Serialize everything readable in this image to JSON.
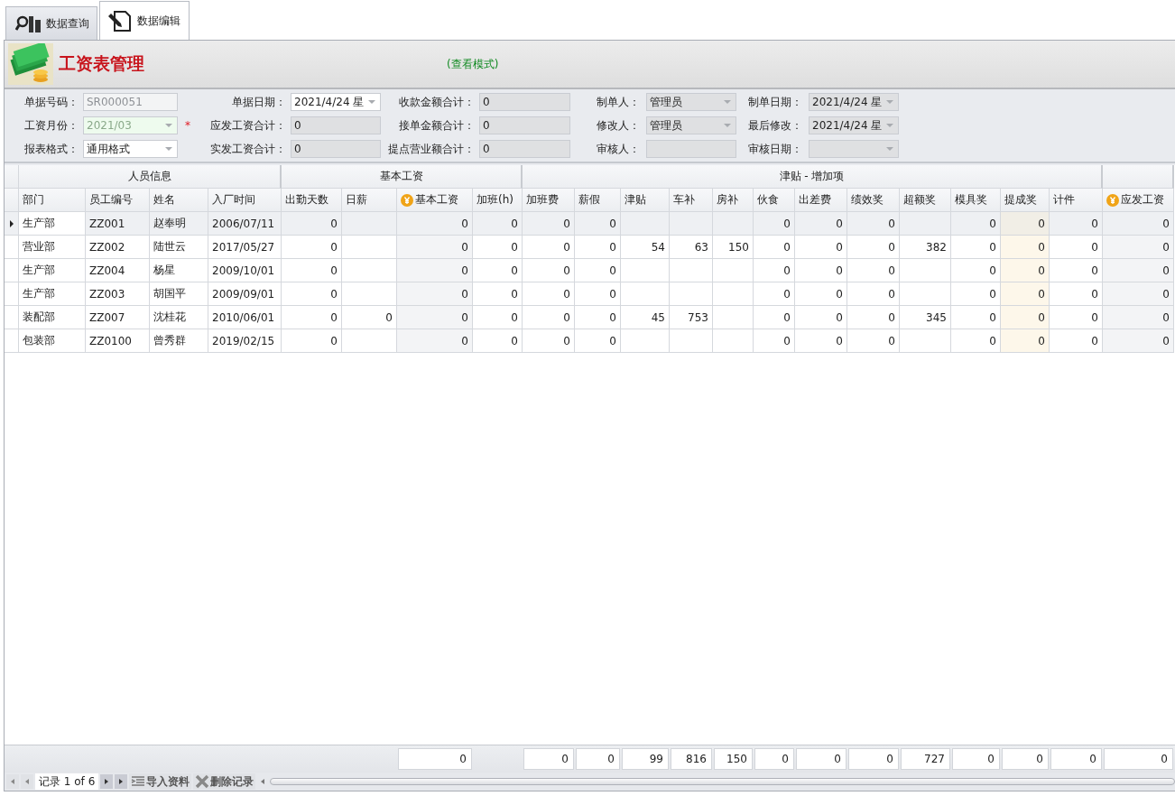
{
  "tabs": [
    {
      "label": "数据查询",
      "kind": "query",
      "selected": false
    },
    {
      "label": "数据编辑",
      "kind": "edit",
      "selected": true
    }
  ],
  "header": {
    "title": "工资表管理",
    "mode": "(查看模式)"
  },
  "form": {
    "rows": [
      [
        {
          "label": "单据号码：",
          "value": "SR000051",
          "dropdown": false,
          "disabled": true,
          "readonly": false,
          "required": false
        },
        {
          "label": "单据日期：",
          "value": "2021/4/24 星",
          "dropdown": true,
          "disabled": false,
          "readonly": false,
          "required": false
        },
        {
          "label": "收款金额合计：",
          "value": "0",
          "dropdown": false,
          "disabled": false,
          "readonly": true,
          "required": false
        },
        {
          "label": "制单人：",
          "value": "管理员",
          "dropdown": true,
          "disabled": false,
          "readonly": true,
          "required": false
        },
        {
          "label": "制单日期：",
          "value": "2021/4/24 星",
          "dropdown": true,
          "disabled": false,
          "readonly": true,
          "required": false
        }
      ],
      [
        {
          "label": "工资月份：",
          "value": "2021/03",
          "dropdown": true,
          "disabled": true,
          "readonly": false,
          "required": true,
          "required_mark": "*"
        },
        {
          "label": "应发工资合计：",
          "value": "0",
          "dropdown": false,
          "disabled": false,
          "readonly": true,
          "required": false
        },
        {
          "label": "接单金额合计：",
          "value": "0",
          "dropdown": false,
          "disabled": false,
          "readonly": true,
          "required": false
        },
        {
          "label": "修改人：",
          "value": "管理员",
          "dropdown": true,
          "disabled": false,
          "readonly": true,
          "required": false
        },
        {
          "label": "最后修改：",
          "value": "2021/4/24 星",
          "dropdown": true,
          "disabled": false,
          "readonly": true,
          "required": false
        }
      ],
      [
        {
          "label": "报表格式：",
          "value": "通用格式",
          "dropdown": true,
          "disabled": false,
          "readonly": false,
          "required": false
        },
        {
          "label": "实发工资合计：",
          "value": "0",
          "dropdown": false,
          "disabled": false,
          "readonly": true,
          "required": false
        },
        {
          "label": "提点营业额合计：",
          "value": "0",
          "dropdown": false,
          "disabled": false,
          "readonly": true,
          "required": false
        },
        {
          "label": "审核人：",
          "dropdown": false,
          "disabled": false,
          "readonly": true,
          "required": false
        },
        {
          "label": "审核日期：",
          "dropdown": true,
          "disabled": false,
          "readonly": true,
          "required": false
        }
      ]
    ]
  },
  "table": {
    "groups": [
      {
        "label": "人员信息",
        "columns": [
          {
            "label": "部门",
            "kind": "text",
            "highlighted": false
          },
          {
            "label": "员工编号",
            "kind": "text",
            "highlighted": false
          },
          {
            "label": "姓名",
            "kind": "text",
            "highlighted": false
          },
          {
            "label": "入厂时间",
            "kind": "text",
            "highlighted": false
          }
        ]
      },
      {
        "label": "基本工资",
        "columns": [
          {
            "label": "出勤天数",
            "kind": "number",
            "highlighted": false
          },
          {
            "label": "日薪",
            "kind": "number",
            "highlighted": false
          },
          {
            "label": "基本工资",
            "kind": "computed",
            "highlighted": false,
            "total": "0"
          },
          {
            "label": "加班(h)",
            "kind": "number",
            "highlighted": false
          }
        ]
      },
      {
        "label": "津贴 - 增加项",
        "columns": [
          {
            "label": "加班费",
            "kind": "number",
            "highlighted": false,
            "total": "0"
          },
          {
            "label": "薪假",
            "kind": "number",
            "highlighted": false,
            "total": "0"
          },
          {
            "label": "津贴",
            "kind": "number",
            "highlighted": false,
            "total": "99"
          },
          {
            "label": "车补",
            "kind": "number",
            "highlighted": false,
            "total": "816"
          },
          {
            "label": "房补",
            "kind": "number",
            "highlighted": false,
            "total": "150"
          },
          {
            "label": "伙食",
            "kind": "number",
            "highlighted": false,
            "total": "0"
          },
          {
            "label": "出差费",
            "kind": "number",
            "highlighted": false,
            "total": "0"
          },
          {
            "label": "绩效奖",
            "kind": "number",
            "highlighted": false,
            "total": "0"
          },
          {
            "label": "超额奖",
            "kind": "number",
            "highlighted": false,
            "total": "727"
          },
          {
            "label": "模具奖",
            "kind": "number",
            "highlighted": false,
            "total": "0"
          },
          {
            "label": "提成奖",
            "kind": "number",
            "highlighted": true,
            "total": "0"
          },
          {
            "label": "计件",
            "kind": "number",
            "highlighted": false,
            "total": "0"
          }
        ]
      },
      {
        "columns": [
          {
            "label": "应发工资",
            "kind": "computed",
            "highlighted": false,
            "total": "0"
          }
        ]
      }
    ],
    "rows": [
      {
        "selected": true,
        "cells": [
          "生产部",
          "ZZ001",
          "赵奉明",
          "2006/07/11",
          "0",
          null,
          "0",
          "0",
          "0",
          "0",
          null,
          null,
          null,
          "0",
          "0",
          "0",
          null,
          "0",
          "0",
          "0",
          "0"
        ]
      },
      {
        "selected": false,
        "cells": [
          "营业部",
          "ZZ002",
          "陆世云",
          "2017/05/27",
          "0",
          null,
          "0",
          "0",
          "0",
          "0",
          "54",
          "63",
          "150",
          "0",
          "0",
          "0",
          "382",
          "0",
          "0",
          "0",
          "0"
        ]
      },
      {
        "selected": false,
        "cells": [
          "生产部",
          "ZZ004",
          "杨星",
          "2009/10/01",
          "0",
          null,
          "0",
          "0",
          "0",
          "0",
          null,
          null,
          null,
          "0",
          "0",
          "0",
          null,
          "0",
          "0",
          "0",
          "0"
        ]
      },
      {
        "selected": false,
        "cells": [
          "生产部",
          "ZZ003",
          "胡国平",
          "2009/09/01",
          "0",
          null,
          "0",
          "0",
          "0",
          "0",
          null,
          null,
          null,
          "0",
          "0",
          "0",
          null,
          "0",
          "0",
          "0",
          "0"
        ]
      },
      {
        "selected": false,
        "cells": [
          "装配部",
          "ZZ007",
          "沈桂花",
          "2010/06/01",
          "0",
          "0",
          "0",
          "0",
          "0",
          "0",
          "45",
          "753",
          null,
          "0",
          "0",
          "0",
          "345",
          "0",
          "0",
          "0",
          "0"
        ]
      },
      {
        "selected": false,
        "cells": [
          "包装部",
          "ZZ0100",
          "曾秀群",
          "2019/02/15",
          "0",
          null,
          "0",
          "0",
          "0",
          "0",
          null,
          null,
          null,
          "0",
          "0",
          "0",
          null,
          "0",
          "0",
          "0",
          "0"
        ]
      }
    ]
  },
  "navigator": {
    "record": "记录 1 of 6",
    "actions": [
      {
        "label": "导入资料",
        "kind": "import"
      },
      {
        "label": "删除记录",
        "kind": "delete"
      }
    ]
  }
}
